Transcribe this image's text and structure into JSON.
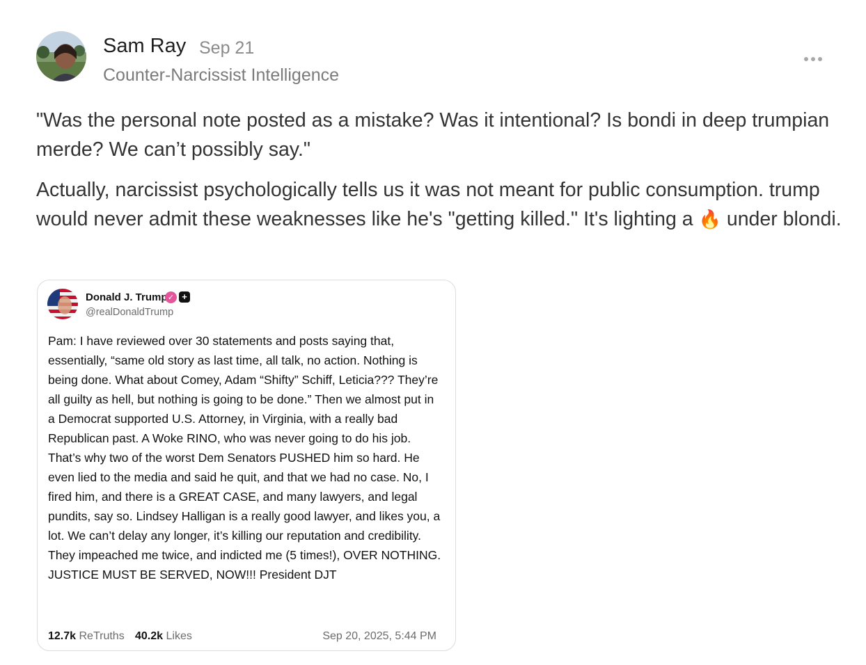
{
  "post": {
    "author": "Sam Ray",
    "date": "Sep 21",
    "publication": "Counter-Narcissist Intelligence",
    "paragraph1": "\"Was the personal note posted as a mistake? Was it intentional? Is bondi in deep trumpian merde? We can’t possibly say.\"",
    "paragraph2_before": "Actually, narcissist psychologically tells us it was not meant for public consumption. trump would never admit these weaknesses like he's \"getting killed.\" It's lighting a ",
    "paragraph2_emoji": "🔥",
    "paragraph2_after": " under blondi.",
    "more_icon": "more-horizontal-icon"
  },
  "embed": {
    "name": "Donald J. Trump",
    "verified_icon": "verified-badge-icon",
    "plus_icon": "plus-badge-icon",
    "verified_color": "#e5559b",
    "handle": "@realDonaldTrump",
    "text": "Pam: I have reviewed over 30 statements and posts saying that, essentially, “same old story as last time, all talk, no action. Nothing is being done. What about Comey, Adam “Shifty” Schiff, Leticia??? They’re all guilty as hell, but nothing is going to be done.” Then we almost put in a Democrat supported U.S. Attorney, in Virginia, with a really bad Republican past. A Woke RINO, who was never going to do his job. That’s why two of the worst Dem Senators PUSHED him so hard. He even lied to the media and said he quit, and that we had no case. No, I fired him, and there is a GREAT CASE, and many lawyers, and legal pundits, say so. Lindsey Halligan is a really good lawyer, and likes you, a lot. We can’t delay any longer, it’s killing our reputation and credibility. They impeached me twice, and indicted me (5 times!), OVER NOTHING. JUSTICE MUST BE SERVED, NOW!!! President DJT",
    "retruths_count": "12.7k",
    "retruths_label": "ReTruths",
    "likes_count": "40.2k",
    "likes_label": "Likes",
    "timestamp": "Sep 20, 2025, 5:44 PM"
  }
}
